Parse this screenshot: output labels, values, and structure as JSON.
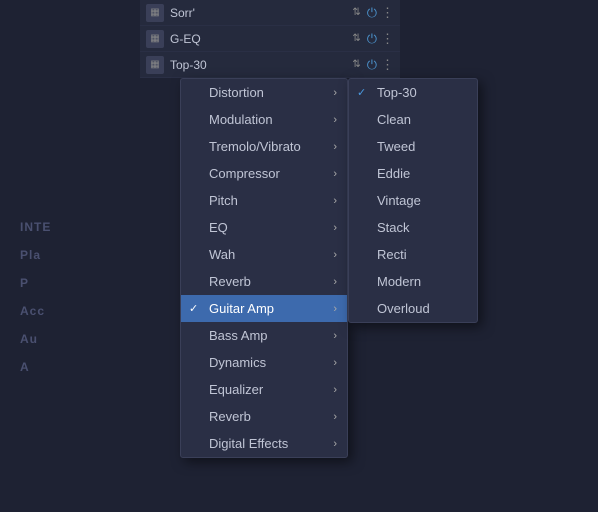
{
  "topBars": [
    {
      "id": "sorr",
      "label": "Sorr'",
      "powerColor": "#4a8fc8"
    },
    {
      "id": "geq",
      "label": "G-EQ",
      "powerColor": "#4a8fc8"
    },
    {
      "id": "top30",
      "label": "Top-30",
      "powerColor": "#4a8fc8"
    }
  ],
  "menu": {
    "items": [
      {
        "id": "distortion",
        "label": "Distortion",
        "hasArrow": true,
        "active": false
      },
      {
        "id": "modulation",
        "label": "Modulation",
        "hasArrow": true,
        "active": false
      },
      {
        "id": "tremolo",
        "label": "Tremolo/Vibrato",
        "hasArrow": true,
        "active": false
      },
      {
        "id": "compressor",
        "label": "Compressor",
        "hasArrow": true,
        "active": false
      },
      {
        "id": "pitch",
        "label": "Pitch",
        "hasArrow": true,
        "active": false
      },
      {
        "id": "eq",
        "label": "EQ",
        "hasArrow": true,
        "active": false
      },
      {
        "id": "wah",
        "label": "Wah",
        "hasArrow": true,
        "active": false
      },
      {
        "id": "reverb1",
        "label": "Reverb",
        "hasArrow": true,
        "active": false
      },
      {
        "id": "guitar-amp",
        "label": "Guitar Amp",
        "hasArrow": true,
        "active": true,
        "checkmark": true
      },
      {
        "id": "bass-amp",
        "label": "Bass Amp",
        "hasArrow": true,
        "active": false
      },
      {
        "id": "dynamics",
        "label": "Dynamics",
        "hasArrow": true,
        "active": false
      },
      {
        "id": "equalizer",
        "label": "Equalizer",
        "hasArrow": true,
        "active": false
      },
      {
        "id": "reverb2",
        "label": "Reverb",
        "hasArrow": true,
        "active": false
      },
      {
        "id": "digital-effects",
        "label": "Digital Effects",
        "hasArrow": true,
        "active": false
      }
    ]
  },
  "submenu": {
    "items": [
      {
        "id": "top30",
        "label": "Top-30",
        "selected": true
      },
      {
        "id": "clean",
        "label": "Clean",
        "selected": false
      },
      {
        "id": "tweed",
        "label": "Tweed",
        "selected": false
      },
      {
        "id": "eddie",
        "label": "Eddie",
        "selected": false
      },
      {
        "id": "vintage",
        "label": "Vintage",
        "selected": false
      },
      {
        "id": "stack",
        "label": "Stack",
        "selected": false
      },
      {
        "id": "recti",
        "label": "Recti",
        "selected": false
      },
      {
        "id": "modern",
        "label": "Modern",
        "selected": false
      },
      {
        "id": "overloud",
        "label": "Overloud",
        "selected": false
      }
    ]
  },
  "bgText": {
    "line1": "INTE",
    "lines": [
      "Pla",
      "P",
      "Acc",
      "Au",
      "A"
    ]
  },
  "icons": {
    "power": "⏻",
    "dots": "⋮",
    "updown": "⇅",
    "arrow_right": "›",
    "check": "✓"
  }
}
